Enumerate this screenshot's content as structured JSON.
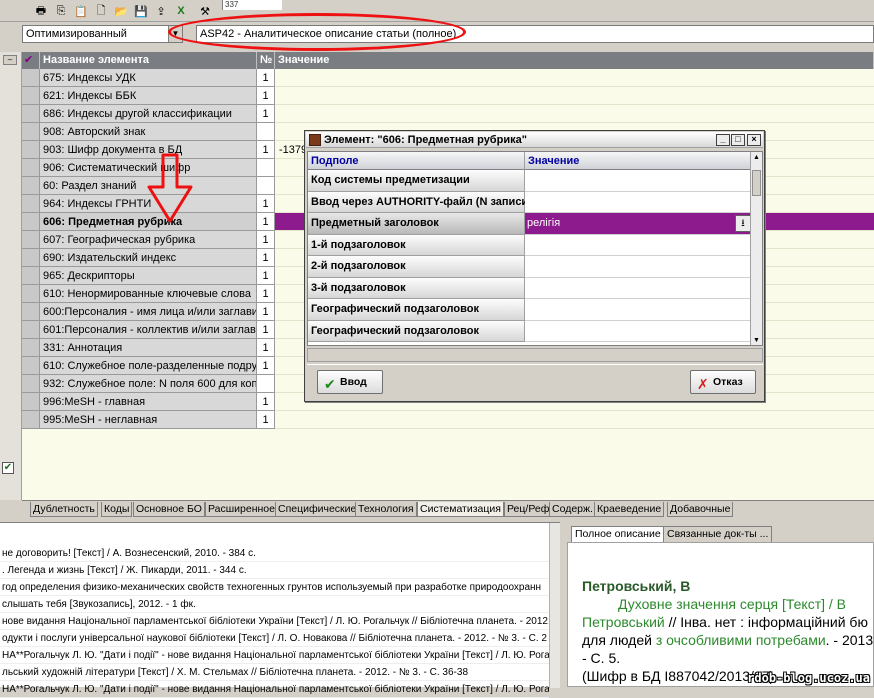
{
  "toolbar": {
    "icons": [
      "print-icon",
      "copy-icon",
      "paste-icon",
      "new-icon",
      "folder-icon",
      "save-icon",
      "export-icon",
      "excel-icon",
      "tools-icon"
    ],
    "cursor_field": "337"
  },
  "selectors": {
    "mode_value": "Оптимизированный",
    "database_value": "ASP42 - Аналитическое описание статьи (полное)"
  },
  "grid": {
    "columns": {
      "check": "✔",
      "name": "Название элемента",
      "num": "№",
      "value": "Значение"
    },
    "rows": [
      {
        "name": "675: Индексы УДК",
        "num": "1",
        "value": ""
      },
      {
        "name": "621: Индексы ББК",
        "num": "1",
        "value": ""
      },
      {
        "name": "686: Индексы другой классификации",
        "num": "1",
        "value": ""
      },
      {
        "name": "908: Авторский знак",
        "num": "",
        "value": ""
      },
      {
        "name": "903: Шифр документа в БД",
        "num": "1",
        "value": "-1379"
      },
      {
        "name": "906: Систематический шифр",
        "num": "",
        "value": ""
      },
      {
        "name": "60: Раздел знаний",
        "num": "",
        "value": ""
      },
      {
        "name": "964: Индексы ГРНТИ",
        "num": "1",
        "value": ""
      },
      {
        "name": "606: Предметная рубрика",
        "num": "1",
        "value": ""
      },
      {
        "name": "607: Географическая рубрика",
        "num": "1",
        "value": ""
      },
      {
        "name": "690: Издательский индекс",
        "num": "1",
        "value": ""
      },
      {
        "name": "965: Дескрипторы",
        "num": "1",
        "value": ""
      },
      {
        "name": "610: Ненормированные ключевые слова",
        "num": "1",
        "value": ""
      },
      {
        "name": "600:Персоналия - имя лица и/или заглавие (о",
        "num": "1",
        "value": ""
      },
      {
        "name": "601:Персоналия - коллектив и/или заглавие (о",
        "num": "1",
        "value": ""
      },
      {
        "name": "331: Аннотация",
        "num": "1",
        "value": ""
      },
      {
        "name": "610: Служебное поле-разделенные подрубрик",
        "num": "1",
        "value": ""
      },
      {
        "name": "932: Служебное поле: N поля 600 для копирова",
        "num": "",
        "value": ""
      },
      {
        "name": "996:MeSH - главная",
        "num": "1",
        "value": ""
      },
      {
        "name": "995:MeSH - неглавная",
        "num": "1",
        "value": ""
      }
    ],
    "selected_row_index": 8
  },
  "tabs": [
    "Дублетность",
    "Коды",
    "Основное БО",
    "Расширенное",
    "Специфические",
    "Технология",
    "Систематизация",
    "Рец/Реф",
    "Содерж.",
    "Краеведение",
    "Добавочные"
  ],
  "active_tab": "Систематизация",
  "dialog": {
    "title": "Элемент: \"606: Предметная рубрика\"",
    "columns": {
      "subfield": "Подполе",
      "value": "Значение"
    },
    "rows": [
      {
        "subfield": "Код системы предметизации",
        "value": ""
      },
      {
        "subfield": "Ввод через AUTHORITY-файл (N записи)",
        "value": ""
      },
      {
        "subfield": "Предметный заголовок",
        "value": "релігія"
      },
      {
        "subfield": "1-й подзаголовок",
        "value": ""
      },
      {
        "subfield": "2-й подзаголовок",
        "value": ""
      },
      {
        "subfield": "3-й подзаголовок",
        "value": ""
      },
      {
        "subfield": "Географический подзаголовок",
        "value": ""
      },
      {
        "subfield": "Географический подзаголовок",
        "value": ""
      }
    ],
    "ok_label": "Ввод",
    "cancel_label": "Отказ",
    "window_buttons": [
      "_",
      "□",
      "×"
    ]
  },
  "bottom_list": [
    "не договорить! [Текст] / А. Вознесенский, 2010. - 384 с.",
    ". Легенда и жизнь [Текст] / Ж. Пикарди, 2011. - 344 с.",
    "год определения физико-механических свойств техногенных грунтов используемый при разработке природоохранн",
    "слышать тебя [Звукозапись], 2012. - 1 фк.",
    "нове видання Національної парламентської бібліотеки України [Текст] / Л. Ю. Рогальчук // Бібліотечна планета. - 2012.",
    "одукти і послуги універсальної наукової бібліотеки [Текст] / Л. О. Новакова // Бібліотечна планета. - 2012. - № 3. - С. 2",
    "НА**Рогальчук Л. Ю. \"Дати і події\" - нове видання Національної парламентської бібліотеки України [Текст] / Л. Ю. Рогальчук",
    "льський художній літератури [Текст] / Х. М. Стельмах // Бібліотечна планета. - 2012. - № 3. - С. 36-38",
    "НА**Рогальчук Л. Ю. \"Дати і події\" - нове видання Національної парламентської бібліотеки України [Текст] / Л. Ю. Рогальчук"
  ],
  "description": {
    "tabs": [
      "Полное описание",
      "Связанные док-ты ..."
    ],
    "author": "Петровський, В",
    "line1": "Духовне значення серця [Текст] / В",
    "line2_a": "Петровський",
    "line2_b": " // Інва. нет : інформаційний бю",
    "line3_a": "для людей ",
    "line3_b": "з очсобливими потребами",
    "line3_c": ". - 2013",
    "line4": "- С. 5.",
    "line5": "(Шифр в БД I887042/2013/27)",
    "watermark": "rdob-blog.ucoz.ua"
  }
}
